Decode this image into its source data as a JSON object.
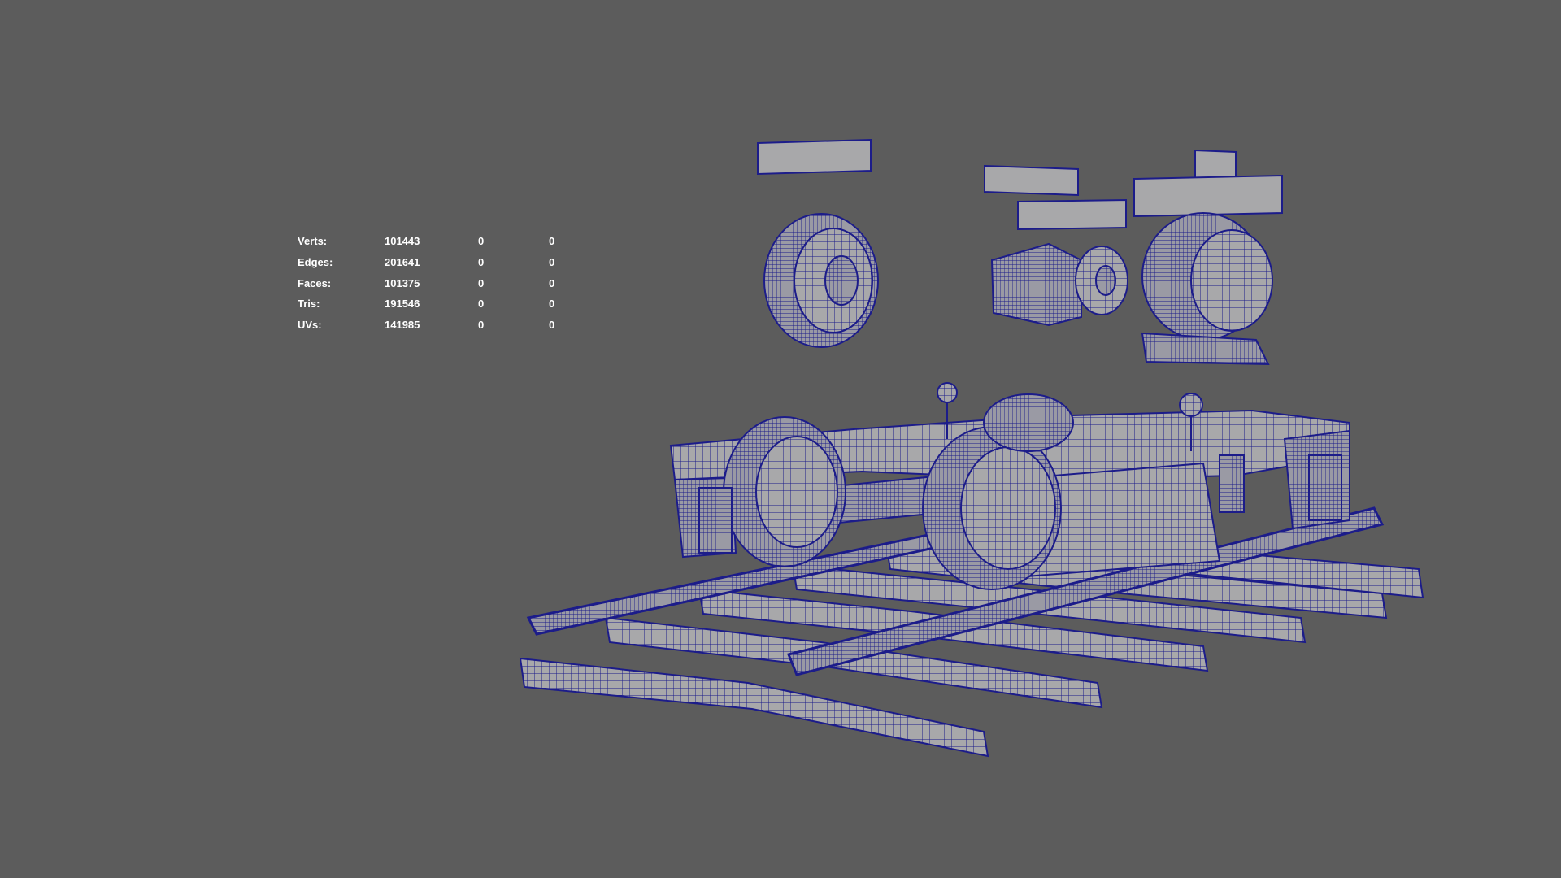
{
  "viewport": {
    "background": "#5c5c5c",
    "wire_color": "#1c1c8a",
    "surface_color": "#a8a8aa"
  },
  "hud": {
    "rows": [
      {
        "label": "Verts:",
        "v1": "101443",
        "v2": "0",
        "v3": "0"
      },
      {
        "label": "Edges:",
        "v1": "201641",
        "v2": "0",
        "v3": "0"
      },
      {
        "label": "Faces:",
        "v1": "101375",
        "v2": "0",
        "v3": "0"
      },
      {
        "label": "Tris:",
        "v1": "191546",
        "v2": "0",
        "v3": "0"
      },
      {
        "label": "UVs:",
        "v1": "141985",
        "v2": "0",
        "v3": "0"
      }
    ]
  },
  "icons": {
    "scene": "wireframe-bogie-model"
  }
}
